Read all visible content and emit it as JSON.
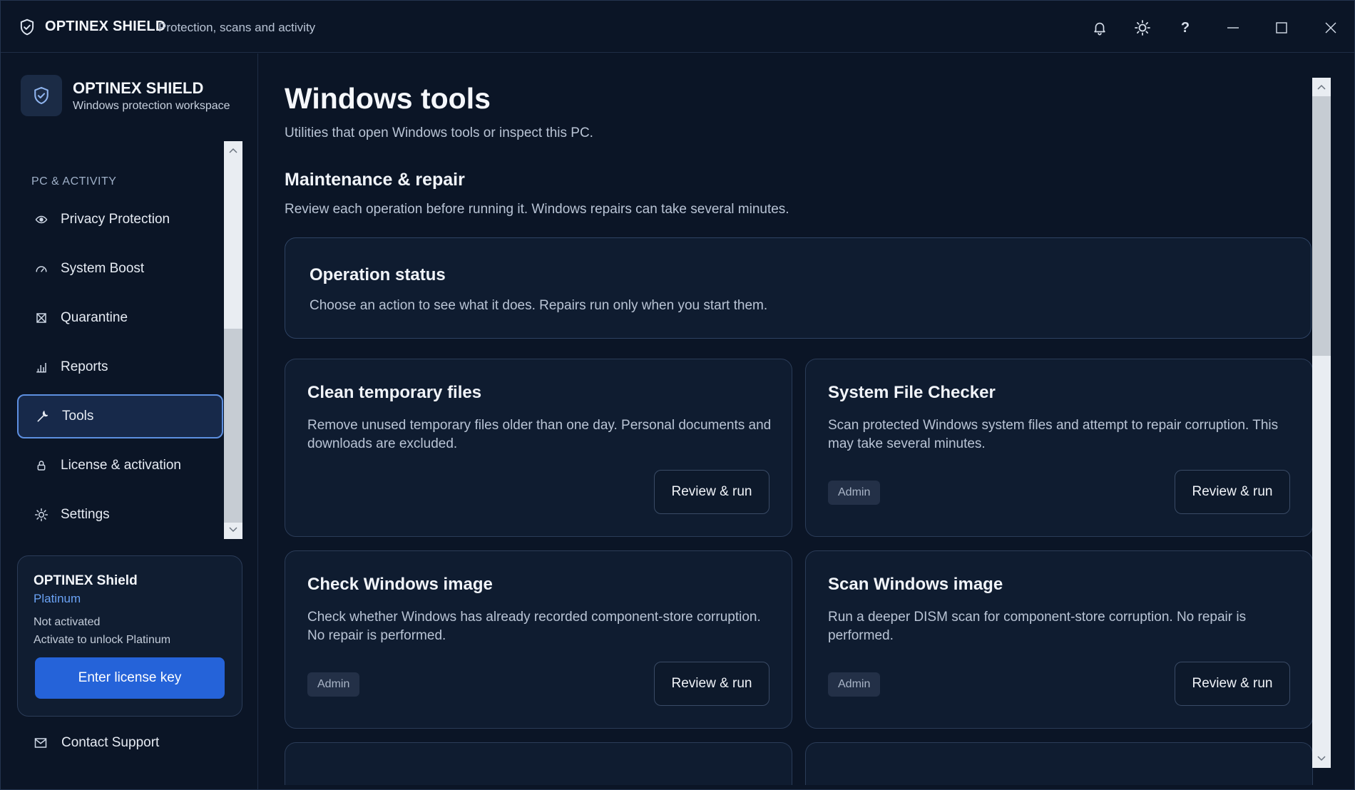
{
  "titlebar": {
    "app_name": "OPTINEX SHIELD",
    "subtitle": "Protection, scans and activity",
    "help_label": "?"
  },
  "sidebar": {
    "brand_name": "OPTINEX SHIELD",
    "brand_sub": "Windows protection workspace",
    "section_label": "PC & ACTIVITY",
    "items": [
      {
        "label": "Privacy Protection",
        "icon": "eye-icon"
      },
      {
        "label": "System Boost",
        "icon": "speedometer-icon"
      },
      {
        "label": "Quarantine",
        "icon": "quarantine-box-icon"
      },
      {
        "label": "Reports",
        "icon": "bar-chart-icon"
      },
      {
        "label": "Tools",
        "icon": "wrench-icon",
        "active": true
      },
      {
        "label": "License & activation",
        "icon": "lock-icon"
      },
      {
        "label": "Settings",
        "icon": "gear-icon"
      }
    ],
    "license": {
      "title": "OPTINEX Shield",
      "tier": "Platinum",
      "status": "Not activated",
      "hint": "Activate to unlock Platinum",
      "button": "Enter license key"
    },
    "support_label": "Contact Support"
  },
  "main": {
    "title": "Windows tools",
    "subtitle": "Utilities that open Windows tools or inspect this PC.",
    "section_title": "Maintenance & repair",
    "section_sub": "Review each operation before running it. Windows repairs can take several minutes.",
    "status": {
      "title": "Operation status",
      "desc": "Choose an action to see what it does. Repairs run only when you start them."
    },
    "tools": [
      {
        "title": "Clean temporary files",
        "desc": "Remove unused temporary files older than one day. Personal documents and downloads are excluded.",
        "badge": "",
        "button": "Review & run"
      },
      {
        "title": "System File Checker",
        "desc": "Scan protected Windows system files and attempt to repair corruption. This may take several minutes.",
        "badge": "Admin",
        "button": "Review & run"
      },
      {
        "title": "Check Windows image",
        "desc": "Check whether Windows has already recorded component-store corruption. No repair is performed.",
        "badge": "Admin",
        "button": "Review & run"
      },
      {
        "title": "Scan Windows image",
        "desc": "Run a deeper DISM scan for component-store corruption. No repair is performed.",
        "badge": "Admin",
        "button": "Review & run"
      }
    ]
  },
  "colors": {
    "background": "#0b1526",
    "card": "#0f1c30",
    "accent": "#2563d9",
    "accent_text": "#6aa2f4",
    "active_border": "#5d8fe0"
  }
}
